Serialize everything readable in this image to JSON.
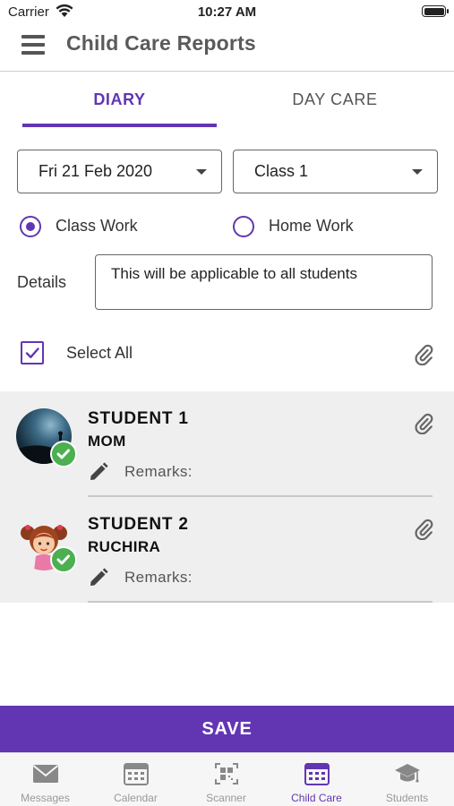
{
  "status_bar": {
    "carrier": "Carrier",
    "time": "10:27 AM"
  },
  "header": {
    "title": "Child Care Reports",
    "menu_icon": "hamburger-menu-icon"
  },
  "tabs": [
    {
      "label": "DIARY",
      "active": true
    },
    {
      "label": "DAY CARE",
      "active": false
    }
  ],
  "filters": {
    "date": "Fri 21 Feb 2020",
    "class": "Class 1"
  },
  "work_type": {
    "options": [
      {
        "label": "Class Work",
        "selected": true
      },
      {
        "label": "Home Work",
        "selected": false
      }
    ]
  },
  "details": {
    "label": "Details",
    "value": "This will be applicable to all students"
  },
  "select_all": {
    "label": "Select All",
    "checked": true
  },
  "students": [
    {
      "name": "STUDENT 1",
      "parent": "MOM",
      "remarks_label": "Remarks:",
      "remarks_value": "",
      "selected": true
    },
    {
      "name": "STUDENT 2",
      "parent": "RUCHIRA",
      "remarks_label": "Remarks:",
      "remarks_value": "",
      "selected": true
    }
  ],
  "save_label": "SAVE",
  "bottom_nav": [
    {
      "label": "Messages",
      "icon": "envelope-icon",
      "active": false
    },
    {
      "label": "Calendar",
      "icon": "calendar-icon",
      "active": false
    },
    {
      "label": "Scanner",
      "icon": "qr-scanner-icon",
      "active": false
    },
    {
      "label": "Child Care",
      "icon": "calendar-grid-icon",
      "active": true
    },
    {
      "label": "Students",
      "icon": "graduation-cap-icon",
      "active": false
    }
  ],
  "colors": {
    "accent": "#6236b3",
    "success": "#4caf50",
    "list_background": "#efefef"
  }
}
